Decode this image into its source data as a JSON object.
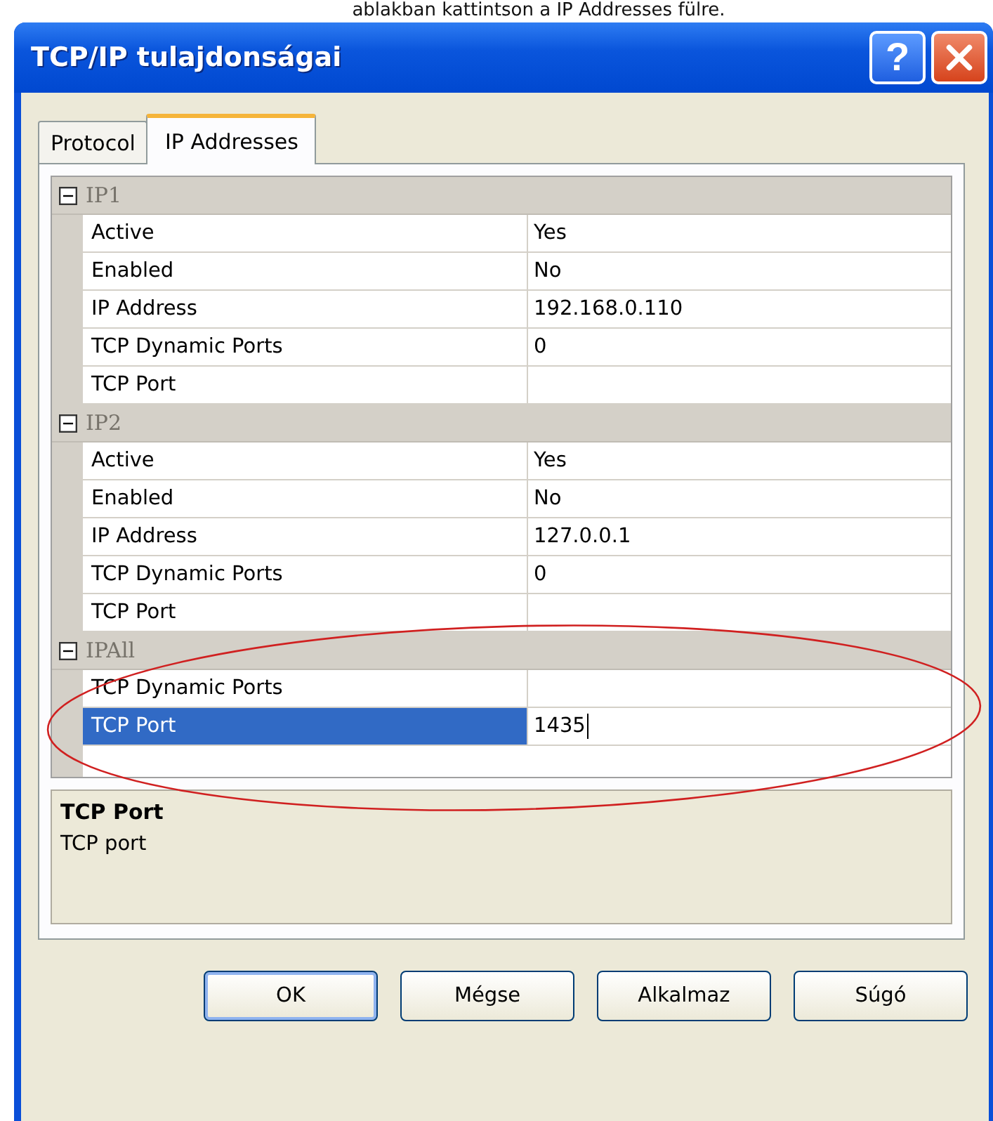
{
  "caption": "ablakban kattintson a IP Addresses fülre.",
  "window": {
    "title": "TCP/IP tulajdonságai",
    "help_button": "?"
  },
  "tabs": [
    {
      "label": "Protocol",
      "selected": false
    },
    {
      "label": "IP Addresses",
      "selected": true
    }
  ],
  "groups": [
    {
      "name": "IP1",
      "expanded": true,
      "properties": [
        {
          "name": "Active",
          "value": "Yes",
          "selected": false,
          "editing": false
        },
        {
          "name": "Enabled",
          "value": "No",
          "selected": false,
          "editing": false
        },
        {
          "name": "IP Address",
          "value": "192.168.0.110",
          "selected": false,
          "editing": false
        },
        {
          "name": "TCP Dynamic Ports",
          "value": "0",
          "selected": false,
          "editing": false
        },
        {
          "name": "TCP Port",
          "selected": false,
          "editing": false
        }
      ]
    },
    {
      "name": "IP2",
      "expanded": true,
      "properties": [
        {
          "name": "Active",
          "value": "Yes",
          "selected": false,
          "editing": false
        },
        {
          "name": "Enabled",
          "value": "No",
          "selected": false,
          "editing": false
        },
        {
          "name": "IP Address",
          "value": "127.0.0.1",
          "selected": false,
          "editing": false
        },
        {
          "name": "TCP Dynamic Ports",
          "value": "0",
          "selected": false,
          "editing": false
        },
        {
          "name": "TCP Port",
          "selected": false,
          "editing": false
        }
      ]
    },
    {
      "name": "IPAll",
      "expanded": true,
      "properties": [
        {
          "name": "TCP Dynamic Ports",
          "selected": false,
          "editing": false
        },
        {
          "name": "TCP Port",
          "value": "1435",
          "selected": true,
          "editing": true
        }
      ]
    }
  ],
  "annotation": {
    "kind": "ellipse"
  },
  "description": {
    "title": "TCP Port",
    "text": "TCP port"
  },
  "buttons": [
    {
      "label": "OK",
      "default": true
    },
    {
      "label": "Mégse",
      "default": false
    },
    {
      "label": "Alkalmaz",
      "default": false
    },
    {
      "label": "Súgó",
      "default": false
    }
  ]
}
